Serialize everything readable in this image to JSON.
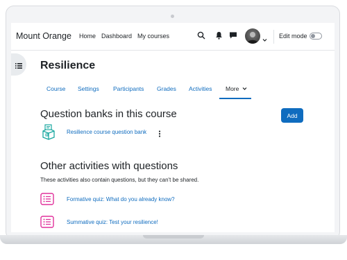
{
  "navbar": {
    "brand": "Mount Orange",
    "links": [
      "Home",
      "Dashboard",
      "My courses"
    ],
    "edit_mode_label": "Edit mode"
  },
  "course": {
    "title": "Resilience",
    "tabs": [
      "Course",
      "Settings",
      "Participants",
      "Grades",
      "Activities",
      "More"
    ],
    "active_tab": "More"
  },
  "question_banks": {
    "heading": "Question banks in this course",
    "add_label": "Add",
    "items": [
      {
        "label": "Resilience course question bank"
      }
    ]
  },
  "other_activities": {
    "heading": "Other activities with questions",
    "description": "These activities also contain questions, but they can't be shared.",
    "items": [
      {
        "label": "Formative quiz: What do you already know?"
      },
      {
        "label": "Summative quiz: Test your resilience!"
      }
    ]
  },
  "colors": {
    "primary": "#0f6cbf",
    "quiz_icon": "#e0309b",
    "bank_icon": "#1aa8a0",
    "text": "#1d2125"
  },
  "icons": [
    "search-icon",
    "bell-icon",
    "chat-icon",
    "chevron-down-icon",
    "drawer-list-icon",
    "question-bank-icon",
    "kebab-menu-icon",
    "quiz-icon"
  ]
}
